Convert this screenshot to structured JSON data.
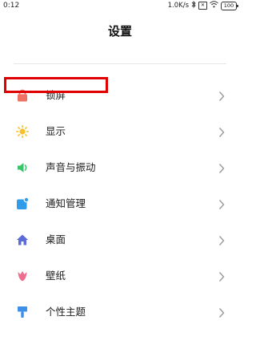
{
  "status_bar": {
    "time": "0:12",
    "speed": "1.0K/s",
    "bluetooth_icon": "bluetooth-icon",
    "sim_icon": "sim-icon",
    "sim_label": "✕",
    "wifi_icon": "wifi-icon",
    "battery_level": "100"
  },
  "header": {
    "title": "设置"
  },
  "settings": {
    "items": [
      {
        "label": "锁屏",
        "icon": "lock-icon",
        "color": "#F07262"
      },
      {
        "label": "显示",
        "icon": "sun-icon",
        "color": "#F8C02C"
      },
      {
        "label": "声音与振动",
        "icon": "speaker-icon",
        "color": "#3BC46B"
      },
      {
        "label": "通知管理",
        "icon": "notification-icon",
        "color": "#2F9CEB"
      },
      {
        "label": "桌面",
        "icon": "home-icon",
        "color": "#5B6BD8"
      },
      {
        "label": "壁纸",
        "icon": "tulip-icon",
        "color": "#EE6E8E"
      },
      {
        "label": "个性主题",
        "icon": "brush-icon",
        "color": "#3D8FEA"
      }
    ]
  },
  "annotation": {
    "highlight_color": "#E00000"
  }
}
